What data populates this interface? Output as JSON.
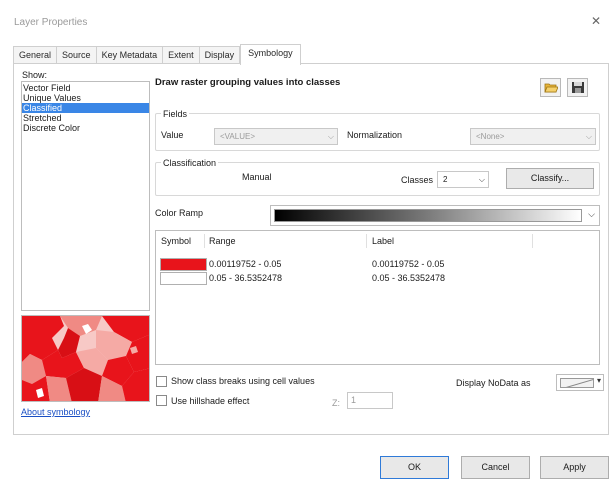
{
  "window": {
    "title": "Layer Properties",
    "close_glyph": "✕"
  },
  "tabs": [
    {
      "label": "General",
      "active": false
    },
    {
      "label": "Source",
      "active": false
    },
    {
      "label": "Key Metadata",
      "active": false
    },
    {
      "label": "Extent",
      "active": false
    },
    {
      "label": "Display",
      "active": false
    },
    {
      "label": "Symbology",
      "active": true
    }
  ],
  "show": {
    "label": "Show:",
    "items": [
      {
        "label": "Vector Field",
        "selected": false
      },
      {
        "label": "Unique Values",
        "selected": false
      },
      {
        "label": "Classified",
        "selected": true
      },
      {
        "label": "Stretched",
        "selected": false
      },
      {
        "label": "Discrete Color",
        "selected": false
      }
    ],
    "about_link": "About symbology"
  },
  "main": {
    "heading": "Draw raster grouping values into classes",
    "open_icon": "folder-open-icon",
    "save_icon": "save-disk-icon",
    "fields": {
      "legend": "Fields",
      "value_label": "Value",
      "value_selected": "<VALUE>",
      "normalization_label": "Normalization",
      "normalization_selected": "<None>"
    },
    "classification": {
      "legend": "Classification",
      "method": "Manual",
      "classes_label": "Classes",
      "classes_value": "2",
      "classify_button": "Classify..."
    },
    "color_ramp": {
      "label": "Color Ramp",
      "start_color": "#000000",
      "end_color": "#ffffff"
    },
    "table": {
      "headers": {
        "symbol": "Symbol",
        "range": "Range",
        "label": "Label"
      },
      "rows": [
        {
          "color": "#e8141b",
          "range": "0.00119752 - 0.05",
          "label": "0.00119752 - 0.05"
        },
        {
          "color": "#ffffff",
          "range": "0.05 - 36.5352478",
          "label": "0.05 - 36.5352478"
        }
      ]
    },
    "show_breaks_label": "Show class breaks using cell values",
    "hillshade_label": "Use hillshade effect",
    "z_label": "Z:",
    "z_value": "1",
    "nodata_label": "Display NoData as"
  },
  "footer": {
    "ok": "OK",
    "cancel": "Cancel",
    "apply": "Apply"
  }
}
